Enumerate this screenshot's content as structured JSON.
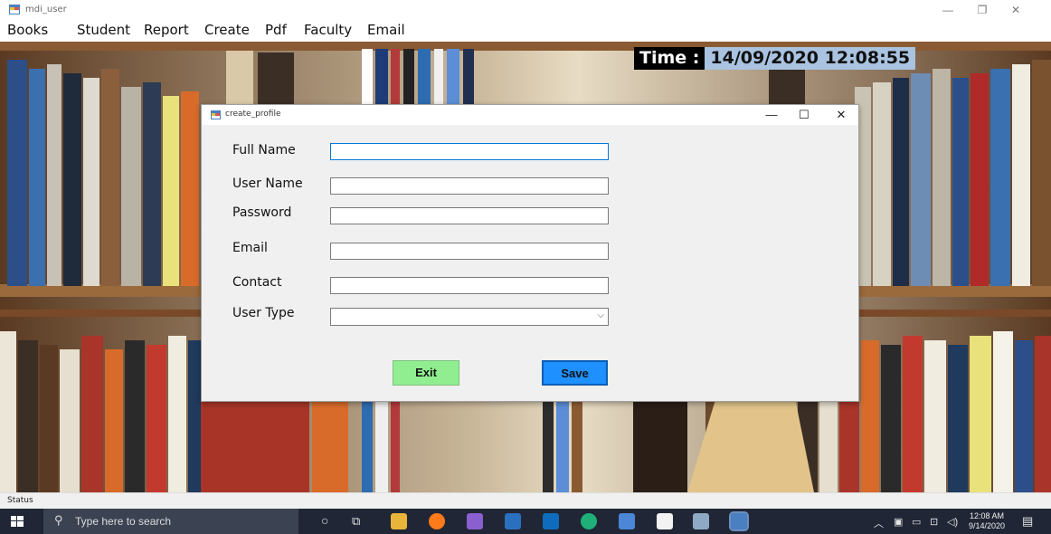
{
  "window": {
    "title": "mdi_user"
  },
  "menu": [
    "Books",
    "Student",
    "Report",
    "Create",
    "Pdf",
    "Faculty",
    "Email"
  ],
  "clock_panel": {
    "label": "Time :",
    "value": "14/09/2020 12:08:55"
  },
  "dialog": {
    "title": "create_profile",
    "fields": [
      {
        "label": "Full Name",
        "value": ""
      },
      {
        "label": "User Name",
        "value": ""
      },
      {
        "label": "Password",
        "value": ""
      },
      {
        "label": "Email",
        "value": ""
      },
      {
        "label": "Contact",
        "value": ""
      },
      {
        "label": "User Type",
        "value": ""
      }
    ],
    "buttons": {
      "exit": "Exit",
      "save": "Save"
    }
  },
  "status": "Status",
  "taskbar": {
    "search_placeholder": "Type here to search",
    "time": "12:08 AM",
    "date": "9/14/2020"
  },
  "colors": {
    "exit_button": "#90ee90",
    "save_button": "#1e90ff",
    "time_label_bg": "#000000",
    "time_value_bg": "#a9c3e0",
    "taskbar_bg": "#202635"
  }
}
